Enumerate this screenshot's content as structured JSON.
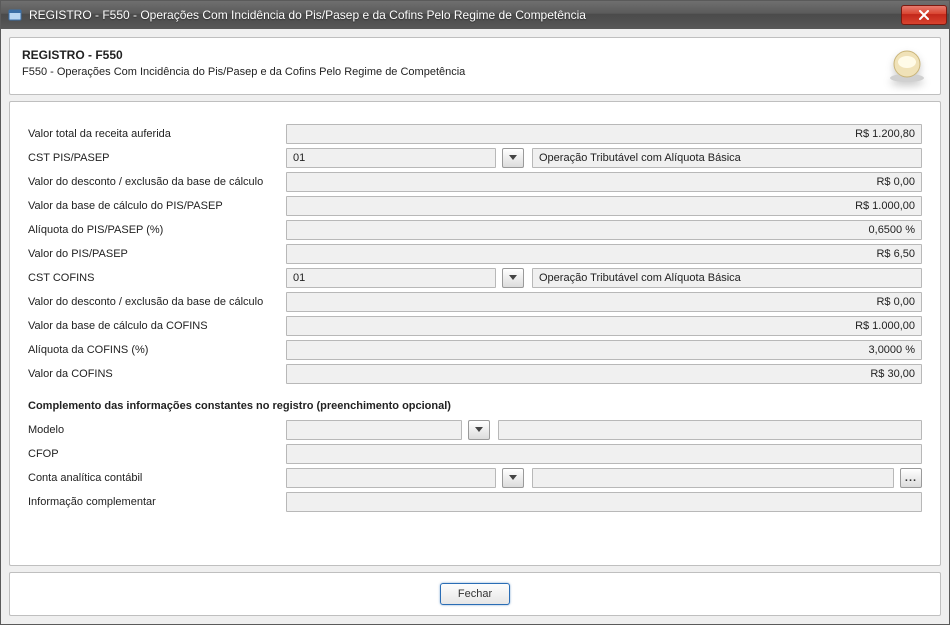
{
  "window": {
    "title": "REGISTRO - F550 - Operações Com Incidência do Pis/Pasep e da Cofins Pelo Regime de Competência"
  },
  "header": {
    "title": "REGISTRO - F550",
    "subtitle": "F550 - Operações Com Incidência do Pis/Pasep e da Cofins Pelo Regime de Competência"
  },
  "labels": {
    "receita": "Valor total da receita auferida",
    "cst_pis": "CST PIS/PASEP",
    "desc_pis": "Valor do desconto / exclusão da base de cálculo",
    "base_pis": "Valor da base de cálculo do PIS/PASEP",
    "aliq_pis": "Alíquota do PIS/PASEP (%)",
    "val_pis": "Valor do PIS/PASEP",
    "cst_cofins": "CST COFINS",
    "desc_cofins": "Valor do desconto / exclusão da base de cálculo",
    "base_cofins": "Valor da base de cálculo da COFINS",
    "aliq_cofins": "Alíquota da COFINS (%)",
    "val_cofins": "Valor da COFINS",
    "section_comp": "Complemento das informações constantes no registro (preenchimento opcional)",
    "modelo": "Modelo",
    "cfop": "CFOP",
    "conta": "Conta analítica contábil",
    "info": "Informação complementar"
  },
  "values": {
    "receita": "R$ 1.200,80",
    "cst_pis_code": "01",
    "cst_pis_desc": "Operação Tributável com Alíquota Básica",
    "desc_pis": "R$ 0,00",
    "base_pis": "R$ 1.000,00",
    "aliq_pis": "0,6500 %",
    "val_pis": "R$ 6,50",
    "cst_cofins_code": "01",
    "cst_cofins_desc": "Operação Tributável com Alíquota Básica",
    "desc_cofins": "R$ 0,00",
    "base_cofins": "R$ 1.000,00",
    "aliq_cofins": "3,0000 %",
    "val_cofins": "R$ 30,00",
    "modelo_code": "",
    "modelo_desc": "",
    "cfop": "",
    "conta_code": "",
    "conta_desc": "",
    "info": ""
  },
  "footer": {
    "close": "Fechar"
  }
}
